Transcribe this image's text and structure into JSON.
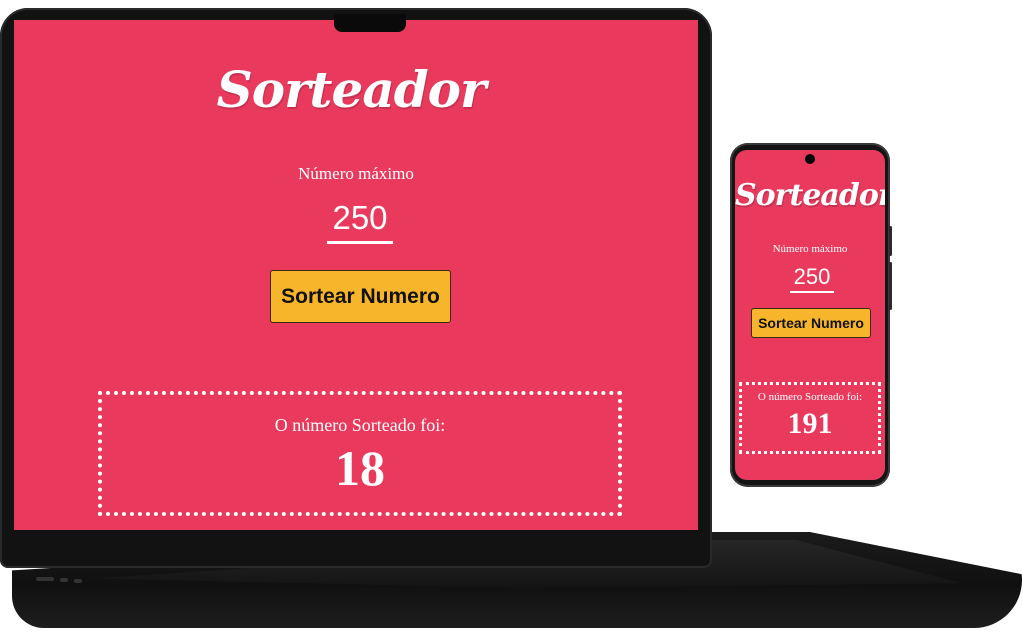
{
  "colors": {
    "background": "#e93a5e",
    "button": "#f7b52b",
    "text": "#ffffff",
    "device_frame": "#121212"
  },
  "desktop": {
    "title": "Sorteador",
    "max_label": "Número máximo",
    "max_value": "250",
    "button_label": "Sortear Numero",
    "result_label": "O número Sorteado foi:",
    "result_value": "18"
  },
  "mobile": {
    "title": "Sorteador",
    "max_label": "Número máximo",
    "max_value": "250",
    "button_label": "Sortear Numero",
    "result_label": "O número Sorteado foi:",
    "result_value": "191"
  }
}
